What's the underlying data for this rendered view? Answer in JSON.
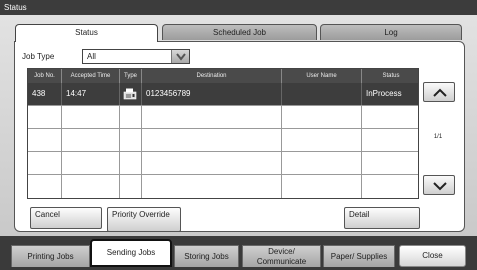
{
  "window": {
    "title": "Status"
  },
  "tabs": [
    {
      "label": "Status",
      "active": true
    },
    {
      "label": "Scheduled Job",
      "active": false
    },
    {
      "label": "Log",
      "active": false
    }
  ],
  "filter": {
    "label": "Job Type",
    "value": "All"
  },
  "table": {
    "columns": [
      "Job No.",
      "Accepted Time",
      "Type",
      "Destination",
      "User Name",
      "Status"
    ],
    "rows": [
      {
        "job_no": "438",
        "accepted_time": "14:47",
        "type_icon": "fax-icon",
        "destination": "0123456789",
        "user_name": "",
        "status": "InProcess",
        "selected": true
      }
    ],
    "empty_rows": 4
  },
  "pager": {
    "text": "1/1"
  },
  "actions": {
    "cancel": "Cancel",
    "priority_override": "Priority Override",
    "detail": "Detail"
  },
  "bottom_tabs": [
    {
      "label": "Printing Jobs",
      "active": false
    },
    {
      "label": "Sending Jobs",
      "active": true
    },
    {
      "label": "Storing Jobs",
      "active": false
    },
    {
      "label": "Device/ Communicate",
      "active": false
    },
    {
      "label": "Paper/ Supplies",
      "active": false
    }
  ],
  "close_label": "Close",
  "colors": {
    "header_bg": "#3c3c3c",
    "selected_row": "#3d3d3d",
    "panel_bg": "#d4d4d4"
  }
}
